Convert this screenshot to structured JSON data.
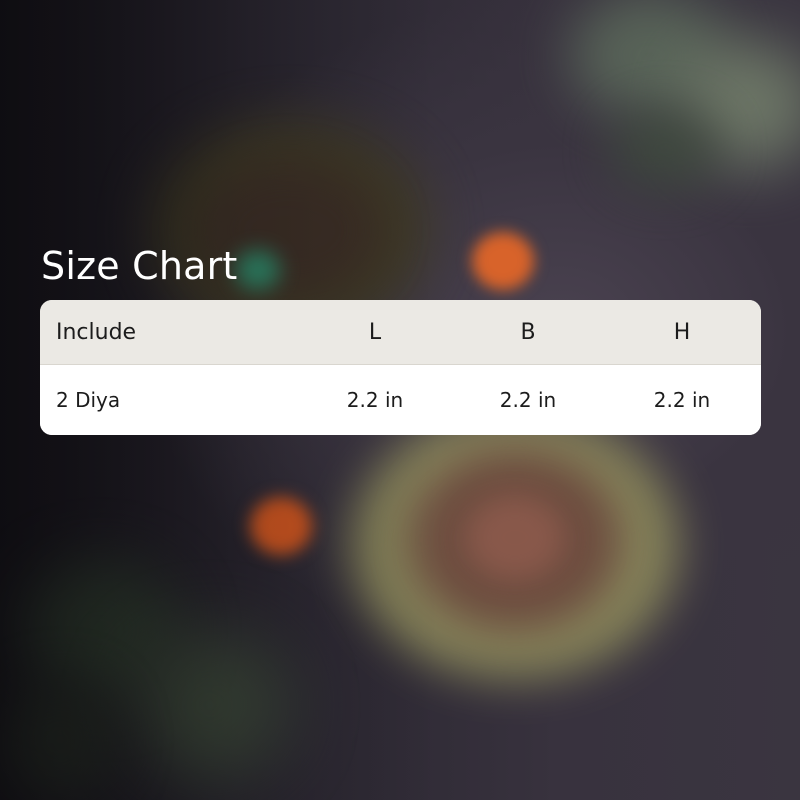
{
  "title": "Size Chart",
  "table": {
    "columns": [
      "Include",
      "L",
      "B",
      "H"
    ],
    "rows": [
      [
        "2 Diya",
        "2.2 in",
        "2.2 in",
        "2.2 in"
      ]
    ]
  },
  "colors": {
    "header_bg": "#ebe9e4",
    "card_bg": "#ffffff",
    "title_text": "#ffffff",
    "table_text": "#1c1c1c"
  }
}
